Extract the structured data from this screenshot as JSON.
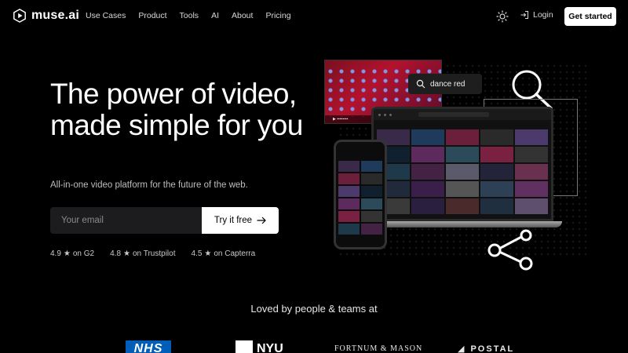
{
  "brand": {
    "name": "muse.ai"
  },
  "nav": {
    "items": [
      "Use Cases",
      "Product",
      "Tools",
      "AI",
      "About",
      "Pricing"
    ],
    "login_label": "Login",
    "cta_label": "Get started"
  },
  "hero": {
    "title": "The power of video, made simple for you",
    "subtitle": "All-in-one video platform for the future of the web.",
    "email_placeholder": "Your email",
    "try_label": "Try it free"
  },
  "ratings": [
    {
      "score": "4.9",
      "source": "on G2"
    },
    {
      "score": "4.8",
      "source": "on Trustpilot"
    },
    {
      "score": "4.5",
      "source": "on Capterra"
    }
  ],
  "illustration": {
    "search_query": "dance red"
  },
  "loved_by": {
    "heading": "Loved by people & teams at",
    "logos": [
      "NHS",
      "NYU",
      "FORTNUM & MASON",
      "POSTAL"
    ]
  },
  "colors": {
    "background": "#000000",
    "cta_bg": "#ffffff",
    "input_bg": "#1c1c1e",
    "nhs_blue": "#005eb8"
  },
  "thumb_colors": [
    "#3a2a4a",
    "#1f3b5c",
    "#6b1f3a",
    "#2a2a2a",
    "#4b3a6b",
    "#10202e",
    "#5c2a5c",
    "#2b4a5a",
    "#7a2040",
    "#333",
    "#1e3a4a",
    "#442244",
    "#5a5a6a",
    "#23233a",
    "#6a3050",
    "#202a3a",
    "#3b1f4b",
    "#555",
    "#2e4055",
    "#603060",
    "#3a3a3a",
    "#2a1f3f",
    "#4a2a2a",
    "#1f2f3f",
    "#5f4f6f"
  ]
}
